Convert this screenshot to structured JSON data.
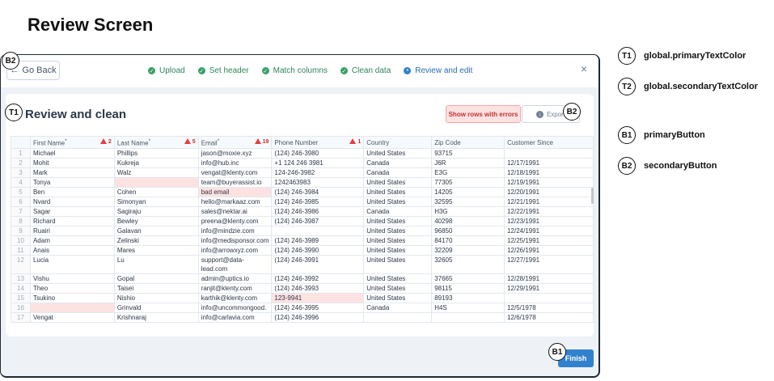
{
  "page": {
    "title": "Review Screen"
  },
  "topbar": {
    "back_label": "Go Back",
    "close_label": "×",
    "steps": [
      {
        "label": "Upload",
        "state": "done"
      },
      {
        "label": "Set header",
        "state": "done"
      },
      {
        "label": "Match columns",
        "state": "done"
      },
      {
        "label": "Clean data",
        "state": "done"
      },
      {
        "label": "Review and edit",
        "state": "active"
      }
    ]
  },
  "card": {
    "title": "Review and clean",
    "show_errors_label": "Show rows with errors",
    "export_label": "Export"
  },
  "table": {
    "columns": [
      {
        "label": "",
        "required": false,
        "errors": ""
      },
      {
        "label": "First Name",
        "required": true,
        "errors": "2"
      },
      {
        "label": "Last Name",
        "required": true,
        "errors": "5"
      },
      {
        "label": "Email",
        "required": true,
        "errors": "19"
      },
      {
        "label": "Phone Number",
        "required": false,
        "errors": "1"
      },
      {
        "label": "Country",
        "required": false,
        "errors": ""
      },
      {
        "label": "Zip Code",
        "required": false,
        "errors": ""
      },
      {
        "label": "Customer Since",
        "required": false,
        "errors": ""
      }
    ],
    "rows": [
      [
        "1",
        "Michael",
        "Phillips",
        "jason@moxie.xyz",
        "(124) 246-3980",
        "United States",
        "93715",
        ""
      ],
      [
        "2",
        "Mohit",
        "Kukreja",
        "info@hub.inc",
        "+1 124 246 3981",
        "Canada",
        "J6R",
        "12/17/1991"
      ],
      [
        "3",
        "Mark",
        "Walz",
        "vengat@klenty.com",
        "124-246-3982",
        "Canada",
        "E3G",
        "12/18/1991"
      ],
      [
        "4",
        "Tonya",
        "",
        "team@buyerassist.io",
        "1242463983",
        "United States",
        "77305",
        "12/19/1991"
      ],
      [
        "5",
        "Ben",
        "Cohen",
        "bad email",
        "(124) 246-3984",
        "United States",
        "14205",
        "12/20/1991"
      ],
      [
        "6",
        "Nvard",
        "Simonyan",
        "hello@markaaz.com",
        "(124) 246-3985",
        "United States",
        "32595",
        "12/21/1991"
      ],
      [
        "7",
        "Sagar",
        "Sagiraju",
        "sales@nektar.ai",
        "(124) 246-3986",
        "Canada",
        "H3G",
        "12/22/1991"
      ],
      [
        "8",
        "Richard",
        "Bewley",
        "preena@klenty.com",
        "(124) 246-3987",
        "United States",
        "40298",
        "12/23/1991"
      ],
      [
        "9",
        "Ruairi",
        "Galavan",
        "info@mindzie.com",
        "",
        "United States",
        "96850",
        "12/24/1991"
      ],
      [
        "10",
        "Adam",
        "Zelinski",
        "info@medisponsor.com",
        "(124) 246-3989",
        "United States",
        "84170",
        "12/25/1991"
      ],
      [
        "11",
        "Anais",
        "Mares",
        "info@arrowxyz.com",
        "(124) 246-3990",
        "United States",
        "32209",
        "12/26/1991"
      ],
      [
        "12",
        "Lucia",
        "Lu",
        "support@data-lead.com",
        "(124) 246-3991",
        "United States",
        "32605",
        "12/27/1991"
      ],
      [
        "13",
        "Vishu",
        "Gopal",
        "admin@uptics.io",
        "(124) 246-3992",
        "United States",
        "37665",
        "12/28/1991"
      ],
      [
        "14",
        "Theo",
        "Taisei",
        "ranjit@klenty.com",
        "(124) 246-3993",
        "United States",
        "98115",
        "12/29/1991"
      ],
      [
        "15",
        "Tsukino",
        "Nishio",
        "karthik@klenty.com",
        "123-9941",
        "United States",
        "89193",
        ""
      ],
      [
        "16",
        "",
        "Grinvald",
        "info@uncommongood.",
        "(124) 246-3995",
        "Canada",
        "H4S",
        "12/5/1978"
      ],
      [
        "17",
        "Vengat",
        "Krishnaraj",
        "info@carlavia.com",
        "(124) 246-3996",
        "",
        "",
        "12/6/1978"
      ]
    ],
    "error_cells": [
      [
        3,
        2
      ],
      [
        4,
        3
      ],
      [
        14,
        4
      ],
      [
        15,
        1
      ]
    ]
  },
  "footer": {
    "finish_label": "Finish"
  },
  "annotations": {
    "T1": "T1",
    "T2": "T2",
    "B1": "B1",
    "B2": "B2"
  },
  "legend": [
    {
      "badge": "T1",
      "text": "global.primaryTextColor"
    },
    {
      "badge": "T2",
      "text": "global.secondaryTextColor"
    },
    {
      "badge": "B1",
      "text": "primaryButton"
    },
    {
      "badge": "B2",
      "text": "secondaryButton"
    }
  ],
  "colors": {
    "primary": "#3182ce",
    "success": "#38a169",
    "error": "#e53e3e",
    "error_bg": "#fde2e2"
  }
}
